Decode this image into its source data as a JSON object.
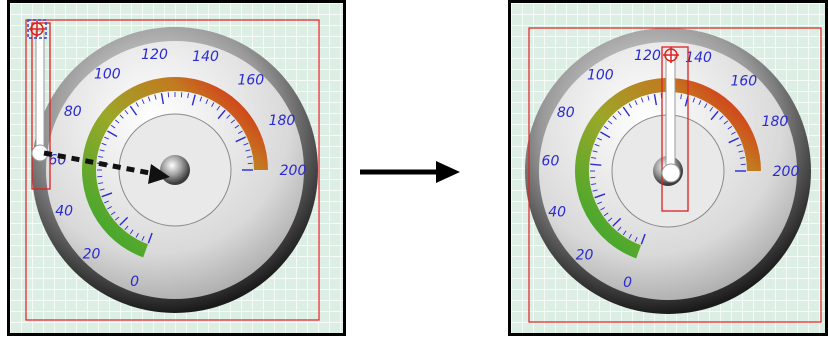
{
  "gauge": {
    "ticks": [
      "0",
      "20",
      "40",
      "60",
      "80",
      "100",
      "120",
      "140",
      "160",
      "180",
      "200"
    ],
    "min": 0,
    "max": 200
  },
  "colors": {
    "grid_bg": "#ddeee4",
    "grid_line": "#ffffff",
    "label_blue": "#2a2ad0",
    "selection_red": "#e02020",
    "handle_blue": "#2a3fd8"
  }
}
